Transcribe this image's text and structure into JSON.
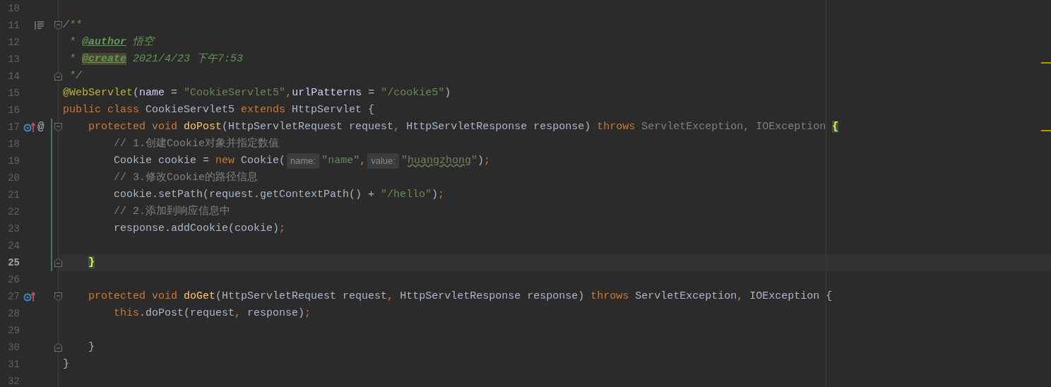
{
  "lines": [
    {
      "number": "10",
      "current": false,
      "changed": false
    },
    {
      "number": "11",
      "current": false,
      "changed": false,
      "fold": {
        "kind": "start"
      },
      "gutter_icons": [
        {
          "kind": "doc"
        }
      ],
      "tokens": [
        {
          "kind": "d",
          "text": "/**"
        }
      ]
    },
    {
      "number": "12",
      "current": false,
      "changed": false,
      "tokens": [
        {
          "kind": "d",
          "text": " * "
        },
        {
          "kind": "dt",
          "text": "@author"
        },
        {
          "kind": "d",
          "text": " 悟空"
        }
      ]
    },
    {
      "number": "13",
      "current": false,
      "changed": false,
      "warning": true,
      "tokens": [
        {
          "kind": "d",
          "text": " * "
        },
        {
          "kind": "dh",
          "text": "@create"
        },
        {
          "kind": "d",
          "text": " 2021/4/23 下午7:53"
        }
      ]
    },
    {
      "number": "14",
      "current": false,
      "changed": false,
      "fold": {
        "kind": "end"
      },
      "tokens": [
        {
          "kind": "d",
          "text": " */"
        }
      ]
    },
    {
      "number": "15",
      "current": false,
      "changed": false,
      "tokens": [
        {
          "kind": "a",
          "text": "@WebServlet"
        },
        {
          "kind": "p",
          "text": "("
        },
        {
          "kind": "n",
          "text": "name"
        },
        {
          "kind": "p",
          "text": " = "
        },
        {
          "kind": "s",
          "text": "\"CookieServlet5\""
        },
        {
          "kind": "k",
          "text": ","
        },
        {
          "kind": "n",
          "text": "urlPatterns"
        },
        {
          "kind": "p",
          "text": " = "
        },
        {
          "kind": "s",
          "text": "\"/cookie5\""
        },
        {
          "kind": "p",
          "text": ")"
        }
      ]
    },
    {
      "number": "16",
      "current": false,
      "changed": false,
      "tokens": [
        {
          "kind": "k",
          "text": "public class "
        },
        {
          "kind": "p",
          "text": "CookieServlet5 "
        },
        {
          "kind": "k",
          "text": "extends "
        },
        {
          "kind": "p",
          "text": "HttpServlet {"
        }
      ]
    },
    {
      "number": "17",
      "current": false,
      "changed": true,
      "fold": {
        "kind": "start"
      },
      "warning": true,
      "gutter_icons": [
        {
          "kind": "override"
        },
        {
          "kind": "symbol",
          "text": "@"
        }
      ],
      "tokens": [
        {
          "kind": "k",
          "text": "    protected void "
        },
        {
          "kind": "m",
          "text": "doPost"
        },
        {
          "kind": "p",
          "text": "(HttpServletRequest request"
        },
        {
          "kind": "k",
          "text": ","
        },
        {
          "kind": "p",
          "text": " HttpServletResponse response) "
        },
        {
          "kind": "k",
          "text": "throws "
        },
        {
          "kind": "g",
          "text": "ServletException, IOException "
        },
        {
          "kind": "b",
          "text": "{"
        }
      ]
    },
    {
      "number": "18",
      "current": false,
      "changed": true,
      "tokens": [
        {
          "kind": "c",
          "text": "        // 1.创建Cookie对象并指定数值"
        }
      ]
    },
    {
      "number": "19",
      "current": false,
      "changed": true,
      "tokens": [
        {
          "kind": "p",
          "text": "        Cookie cookie = "
        },
        {
          "kind": "k",
          "text": "new "
        },
        {
          "kind": "p",
          "text": "Cookie("
        },
        {
          "kind": "h",
          "text": "name:"
        },
        {
          "kind": "s",
          "text": "\"name\""
        },
        {
          "kind": "k",
          "text": ","
        },
        {
          "kind": "h",
          "text": "value:"
        },
        {
          "kind": "s",
          "text": "\""
        },
        {
          "kind": "t",
          "text": "huangzhong"
        },
        {
          "kind": "s",
          "text": "\""
        },
        {
          "kind": "p",
          "text": ")"
        },
        {
          "kind": "k",
          "text": ";"
        }
      ]
    },
    {
      "number": "20",
      "current": false,
      "changed": true,
      "tokens": [
        {
          "kind": "c",
          "text": "        // 3.修改Cookie的路径信息"
        }
      ]
    },
    {
      "number": "21",
      "current": false,
      "changed": true,
      "tokens": [
        {
          "kind": "p",
          "text": "        cookie.setPath(request.getContextPath() + "
        },
        {
          "kind": "s",
          "text": "\"/hello\""
        },
        {
          "kind": "p",
          "text": ")"
        },
        {
          "kind": "k",
          "text": ";"
        }
      ]
    },
    {
      "number": "22",
      "current": false,
      "changed": true,
      "tokens": [
        {
          "kind": "c",
          "text": "        // 2.添加到响应信息中"
        }
      ]
    },
    {
      "number": "23",
      "current": false,
      "changed": true,
      "tokens": [
        {
          "kind": "p",
          "text": "        response.addCookie(cookie)"
        },
        {
          "kind": "k",
          "text": ";"
        }
      ]
    },
    {
      "number": "24",
      "current": false,
      "changed": true
    },
    {
      "number": "25",
      "current": true,
      "changed": true,
      "fold": {
        "kind": "end"
      },
      "tokens": [
        {
          "kind": "b",
          "text": "    }"
        }
      ]
    },
    {
      "number": "26",
      "current": false,
      "changed": false
    },
    {
      "number": "27",
      "current": false,
      "changed": false,
      "fold": {
        "kind": "start"
      },
      "gutter_icons": [
        {
          "kind": "override"
        }
      ],
      "tokens": [
        {
          "kind": "k",
          "text": "    protected void "
        },
        {
          "kind": "m",
          "text": "doGet"
        },
        {
          "kind": "p",
          "text": "(HttpServletRequest request"
        },
        {
          "kind": "k",
          "text": ","
        },
        {
          "kind": "p",
          "text": " HttpServletResponse response) "
        },
        {
          "kind": "k",
          "text": "throws "
        },
        {
          "kind": "p",
          "text": "ServletException"
        },
        {
          "kind": "k",
          "text": ","
        },
        {
          "kind": "p",
          "text": " IOException {"
        }
      ]
    },
    {
      "number": "28",
      "current": false,
      "changed": false,
      "tokens": [
        {
          "kind": "k",
          "text": "        this"
        },
        {
          "kind": "p",
          "text": ".doPost(request"
        },
        {
          "kind": "k",
          "text": ","
        },
        {
          "kind": "p",
          "text": " response)"
        },
        {
          "kind": "k",
          "text": ";"
        }
      ]
    },
    {
      "number": "29",
      "current": false,
      "changed": false
    },
    {
      "number": "30",
      "current": false,
      "changed": false,
      "fold": {
        "kind": "end"
      },
      "tokens": [
        {
          "kind": "p",
          "text": "    }"
        }
      ]
    },
    {
      "number": "31",
      "current": false,
      "changed": false,
      "tokens": [
        {
          "kind": "p",
          "text": "}"
        }
      ]
    },
    {
      "number": "32",
      "current": false,
      "changed": false
    }
  ]
}
